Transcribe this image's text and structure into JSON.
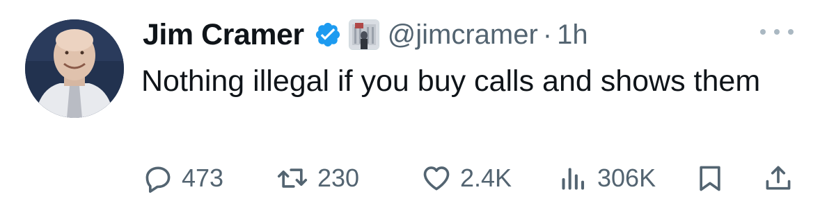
{
  "author": {
    "display_name": "Jim Cramer",
    "handle": "@jimcramer",
    "time": "1h",
    "separator": "·"
  },
  "tweet": {
    "text": "Nothing illegal if you buy calls and shows them"
  },
  "actions": {
    "replies": "473",
    "retweets": "230",
    "likes": "2.4K",
    "views": "306K"
  },
  "icons": {
    "verified": "verified-badge-icon",
    "affiliate": "affiliate-badge-icon",
    "more": "more-options-icon",
    "reply": "reply-icon",
    "retweet": "retweet-icon",
    "like": "heart-icon",
    "views": "views-bar-chart-icon",
    "bookmark": "bookmark-icon",
    "share": "share-icon"
  },
  "colors": {
    "text_primary": "#0f1419",
    "text_secondary": "#536471",
    "verified_blue": "#1d9bf0"
  }
}
